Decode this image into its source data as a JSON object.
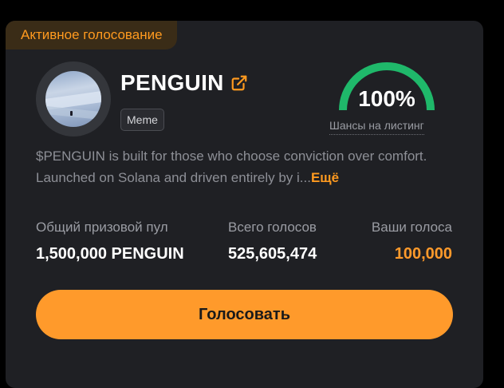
{
  "card": {
    "tag": "Активное голосование",
    "title": "PENGUIN",
    "chip": "Meme",
    "gauge": {
      "value_label": "100%",
      "label": "Шансы на листинг",
      "progress": 1.0,
      "color": "#1fb86a"
    },
    "description": "$PENGUIN is built for those who choose conviction over comfort. Launched on Solana and driven entirely by i...",
    "more_label": "Ещё",
    "stats": {
      "pool_label": "Общий призовой пул",
      "pool_value": "1,500,000 PENGUIN",
      "votes_label": "Всего голосов",
      "votes_value": "525,605,474",
      "my_votes_label": "Ваши голоса",
      "my_votes_value": "100,000"
    },
    "vote_button": "Голосовать"
  },
  "colors": {
    "accent": "#ff9a2b",
    "card_bg": "#1f2024",
    "gauge": "#1fb86a"
  },
  "icons": {
    "external_link": "external-link-icon"
  }
}
